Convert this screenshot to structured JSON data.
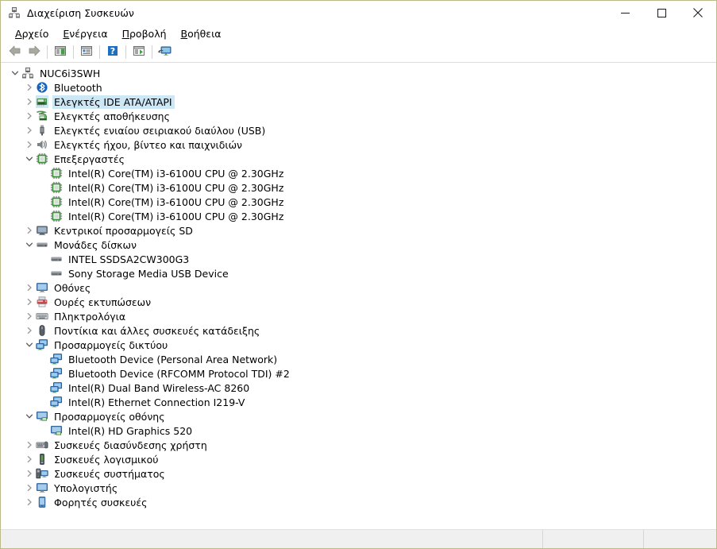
{
  "window": {
    "title": "Διαχείριση Συσκευών",
    "title_icon": "device-manager-icon",
    "border_color": "#b9bc8a",
    "selection_color": "#cce8f7"
  },
  "caption_buttons": [
    {
      "name": "minimize-button",
      "glyph": "minimize"
    },
    {
      "name": "maximize-button",
      "glyph": "maximize"
    },
    {
      "name": "close-button",
      "glyph": "close"
    }
  ],
  "menubar": {
    "items": [
      {
        "name": "menu-file",
        "accel": "Α",
        "rest": "ρχείο"
      },
      {
        "name": "menu-action",
        "accel": "Ε",
        "rest": "νέργεια"
      },
      {
        "name": "menu-view",
        "accel": "Π",
        "rest": "ροβολή"
      },
      {
        "name": "menu-help",
        "accel": "Β",
        "rest": "οήθεια"
      }
    ]
  },
  "toolbar": {
    "buttons": [
      {
        "name": "back-button",
        "icon": "back-arrow-icon"
      },
      {
        "name": "forward-button",
        "icon": "forward-arrow-icon"
      },
      {
        "name": "show-hide-console-tree-button",
        "icon": "console-tree-icon"
      },
      {
        "name": "properties-button",
        "icon": "properties-icon"
      },
      {
        "name": "help-button",
        "icon": "help-question-icon"
      },
      {
        "name": "update-driver-button",
        "icon": "update-driver-icon"
      },
      {
        "name": "scan-hardware-changes-button",
        "icon": "scan-hardware-icon"
      }
    ]
  },
  "tree": {
    "nodes": [
      {
        "name": "tree-node-root",
        "label": "NUC6i3SWH",
        "depth": 0,
        "twisty": "expanded",
        "icon": "computer-root-icon",
        "selected": false
      },
      {
        "name": "tree-node-bluetooth",
        "label": "Bluetooth",
        "depth": 1,
        "twisty": "collapsed",
        "icon": "bluetooth-icon",
        "selected": false
      },
      {
        "name": "tree-node-ide-ata-atapi-controllers",
        "label": "Ελεγκτές IDE ATA/ATAPI",
        "depth": 1,
        "twisty": "collapsed",
        "icon": "ide-controller-icon",
        "selected": true
      },
      {
        "name": "tree-node-storage-controllers",
        "label": "Ελεγκτές αποθήκευσης",
        "depth": 1,
        "twisty": "collapsed",
        "icon": "storage-controller-icon",
        "selected": false
      },
      {
        "name": "tree-node-usb-controllers",
        "label": "Ελεγκτές ενιαίου σειριακού διαύλου (USB)",
        "depth": 1,
        "twisty": "collapsed",
        "icon": "usb-controller-icon",
        "selected": false
      },
      {
        "name": "tree-node-sound-video-game-controllers",
        "label": "Ελεγκτές ήχου, βίντεο και παιχνιδιών",
        "depth": 1,
        "twisty": "collapsed",
        "icon": "speaker-icon",
        "selected": false
      },
      {
        "name": "tree-node-processors",
        "label": "Επεξεργαστές",
        "depth": 1,
        "twisty": "expanded",
        "icon": "processor-icon",
        "selected": false
      },
      {
        "name": "tree-node-cpu-1",
        "label": "Intel(R) Core(TM) i3-6100U CPU @ 2.30GHz",
        "depth": 2,
        "twisty": "none",
        "icon": "processor-icon",
        "selected": false
      },
      {
        "name": "tree-node-cpu-2",
        "label": "Intel(R) Core(TM) i3-6100U CPU @ 2.30GHz",
        "depth": 2,
        "twisty": "none",
        "icon": "processor-icon",
        "selected": false
      },
      {
        "name": "tree-node-cpu-3",
        "label": "Intel(R) Core(TM) i3-6100U CPU @ 2.30GHz",
        "depth": 2,
        "twisty": "none",
        "icon": "processor-icon",
        "selected": false
      },
      {
        "name": "tree-node-cpu-4",
        "label": "Intel(R) Core(TM) i3-6100U CPU @ 2.30GHz",
        "depth": 2,
        "twisty": "none",
        "icon": "processor-icon",
        "selected": false
      },
      {
        "name": "tree-node-sd-host-adapters",
        "label": "Κεντρικοί προσαρμογείς SD",
        "depth": 1,
        "twisty": "collapsed",
        "icon": "sd-host-icon",
        "selected": false
      },
      {
        "name": "tree-node-disk-drives",
        "label": "Μονάδες δίσκων",
        "depth": 1,
        "twisty": "expanded",
        "icon": "disk-drive-icon",
        "selected": false
      },
      {
        "name": "tree-node-disk-intel-ssd",
        "label": "INTEL SSDSA2CW300G3",
        "depth": 2,
        "twisty": "none",
        "icon": "disk-drive-icon",
        "selected": false
      },
      {
        "name": "tree-node-disk-sony-usb",
        "label": "Sony Storage Media USB Device",
        "depth": 2,
        "twisty": "none",
        "icon": "disk-drive-icon",
        "selected": false
      },
      {
        "name": "tree-node-monitors",
        "label": "Οθόνες",
        "depth": 1,
        "twisty": "collapsed",
        "icon": "monitor-icon",
        "selected": false
      },
      {
        "name": "tree-node-print-queues",
        "label": "Ουρές εκτυπώσεων",
        "depth": 1,
        "twisty": "collapsed",
        "icon": "printer-icon",
        "selected": false
      },
      {
        "name": "tree-node-keyboards",
        "label": "Πληκτρολόγια",
        "depth": 1,
        "twisty": "collapsed",
        "icon": "keyboard-icon",
        "selected": false
      },
      {
        "name": "tree-node-mice-pointing-devices",
        "label": "Ποντίκια και άλλες συσκευές κατάδειξης",
        "depth": 1,
        "twisty": "collapsed",
        "icon": "mouse-icon",
        "selected": false
      },
      {
        "name": "tree-node-network-adapters",
        "label": "Προσαρμογείς δικτύου",
        "depth": 1,
        "twisty": "expanded",
        "icon": "network-adapter-icon",
        "selected": false
      },
      {
        "name": "tree-node-net-bt-pan",
        "label": "Bluetooth Device (Personal Area Network)",
        "depth": 2,
        "twisty": "none",
        "icon": "network-adapter-icon",
        "selected": false
      },
      {
        "name": "tree-node-net-bt-rfcomm",
        "label": "Bluetooth Device (RFCOMM Protocol TDI) #2",
        "depth": 2,
        "twisty": "none",
        "icon": "network-adapter-icon",
        "selected": false
      },
      {
        "name": "tree-node-net-wireless-ac8260",
        "label": "Intel(R) Dual Band Wireless-AC 8260",
        "depth": 2,
        "twisty": "none",
        "icon": "network-adapter-icon",
        "selected": false
      },
      {
        "name": "tree-node-net-ethernet-i219v",
        "label": "Intel(R) Ethernet Connection I219-V",
        "depth": 2,
        "twisty": "none",
        "icon": "network-adapter-icon",
        "selected": false
      },
      {
        "name": "tree-node-display-adapters",
        "label": "Προσαρμογείς οθόνης",
        "depth": 1,
        "twisty": "expanded",
        "icon": "display-adapter-icon",
        "selected": false
      },
      {
        "name": "tree-node-display-intel-hd-520",
        "label": "Intel(R) HD Graphics 520",
        "depth": 2,
        "twisty": "none",
        "icon": "display-adapter-icon",
        "selected": false
      },
      {
        "name": "tree-node-human-interface-devices",
        "label": "Συσκευές διασύνδεσης χρήστη",
        "depth": 1,
        "twisty": "collapsed",
        "icon": "hid-icon",
        "selected": false
      },
      {
        "name": "tree-node-software-devices",
        "label": "Συσκευές λογισμικού",
        "depth": 1,
        "twisty": "collapsed",
        "icon": "software-device-icon",
        "selected": false
      },
      {
        "name": "tree-node-system-devices",
        "label": "Συσκευές συστήματος",
        "depth": 1,
        "twisty": "collapsed",
        "icon": "system-device-icon",
        "selected": false
      },
      {
        "name": "tree-node-computer",
        "label": "Υπολογιστής",
        "depth": 1,
        "twisty": "collapsed",
        "icon": "monitor-icon",
        "selected": false
      },
      {
        "name": "tree-node-portable-devices",
        "label": "Φορητές συσκευές",
        "depth": 1,
        "twisty": "collapsed",
        "icon": "portable-device-icon",
        "selected": false
      }
    ]
  },
  "statusbar": {
    "main_text": "",
    "second_text": "",
    "third_text": ""
  }
}
